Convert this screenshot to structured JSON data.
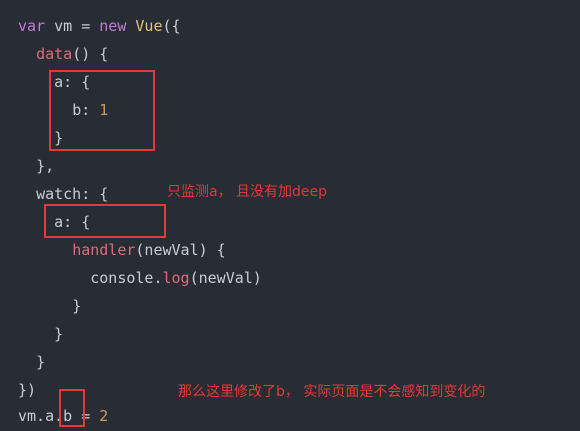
{
  "code": {
    "l1": {
      "kw1": "var",
      "t1": " vm = ",
      "kw2": "new",
      "t2": " ",
      "cls": "Vue",
      "t3": "({"
    },
    "l2": {
      "indent": "  ",
      "fn": "data",
      "rest": "() {"
    },
    "l3": {
      "indent": "    ",
      "text": "a: {"
    },
    "l4": {
      "indent": "      ",
      "prop": "b: ",
      "num": "1"
    },
    "l5": {
      "indent": "    ",
      "text": "}"
    },
    "l6": {
      "indent": "  ",
      "text": "},"
    },
    "l7": {
      "indent": "  ",
      "text": "watch: {"
    },
    "l8": {
      "indent": "    ",
      "text": "a: {"
    },
    "l9": {
      "indent": "      ",
      "fn": "handler",
      "rest": "(newVal) {"
    },
    "l10": {
      "indent": "        ",
      "pre": "console.",
      "fn": "log",
      "rest": "(newVal)"
    },
    "l11": {
      "indent": "      ",
      "text": "}"
    },
    "l12": {
      "indent": "    ",
      "text": "}"
    },
    "l13": {
      "indent": "  ",
      "text": "}"
    },
    "l14": {
      "indent": "",
      "text": "})"
    },
    "l15": {
      "pre": "vm.a.",
      "hl": "b",
      "mid": " = ",
      "num": "2"
    }
  },
  "annotations": {
    "watch_note": "只监测a， 且没有加deep",
    "change_note": "那么这里修改了b，  实际页面是不会感知到变化的"
  },
  "colors": {
    "background": "#282c34",
    "keyword": "#c678dd",
    "class": "#e5c07b",
    "function": "#e06c75",
    "number": "#d19a66",
    "annotation": "#e53935"
  }
}
